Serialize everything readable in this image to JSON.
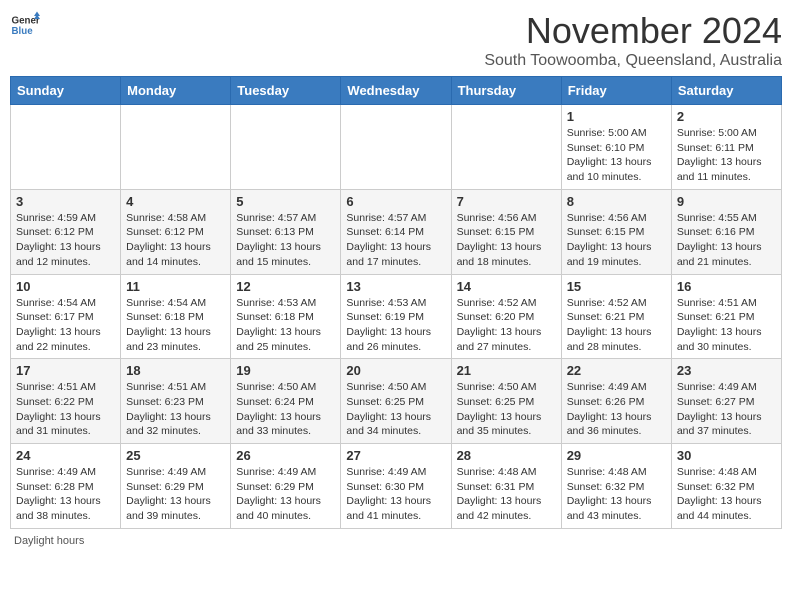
{
  "header": {
    "logo_line1": "General",
    "logo_line2": "Blue",
    "title": "November 2024",
    "subtitle": "South Toowoomba, Queensland, Australia"
  },
  "columns": [
    "Sunday",
    "Monday",
    "Tuesday",
    "Wednesday",
    "Thursday",
    "Friday",
    "Saturday"
  ],
  "weeks": [
    [
      {
        "day": "",
        "detail": ""
      },
      {
        "day": "",
        "detail": ""
      },
      {
        "day": "",
        "detail": ""
      },
      {
        "day": "",
        "detail": ""
      },
      {
        "day": "",
        "detail": ""
      },
      {
        "day": "1",
        "detail": "Sunrise: 5:00 AM\nSunset: 6:10 PM\nDaylight: 13 hours\nand 10 minutes."
      },
      {
        "day": "2",
        "detail": "Sunrise: 5:00 AM\nSunset: 6:11 PM\nDaylight: 13 hours\nand 11 minutes."
      }
    ],
    [
      {
        "day": "3",
        "detail": "Sunrise: 4:59 AM\nSunset: 6:12 PM\nDaylight: 13 hours\nand 12 minutes."
      },
      {
        "day": "4",
        "detail": "Sunrise: 4:58 AM\nSunset: 6:12 PM\nDaylight: 13 hours\nand 14 minutes."
      },
      {
        "day": "5",
        "detail": "Sunrise: 4:57 AM\nSunset: 6:13 PM\nDaylight: 13 hours\nand 15 minutes."
      },
      {
        "day": "6",
        "detail": "Sunrise: 4:57 AM\nSunset: 6:14 PM\nDaylight: 13 hours\nand 17 minutes."
      },
      {
        "day": "7",
        "detail": "Sunrise: 4:56 AM\nSunset: 6:15 PM\nDaylight: 13 hours\nand 18 minutes."
      },
      {
        "day": "8",
        "detail": "Sunrise: 4:56 AM\nSunset: 6:15 PM\nDaylight: 13 hours\nand 19 minutes."
      },
      {
        "day": "9",
        "detail": "Sunrise: 4:55 AM\nSunset: 6:16 PM\nDaylight: 13 hours\nand 21 minutes."
      }
    ],
    [
      {
        "day": "10",
        "detail": "Sunrise: 4:54 AM\nSunset: 6:17 PM\nDaylight: 13 hours\nand 22 minutes."
      },
      {
        "day": "11",
        "detail": "Sunrise: 4:54 AM\nSunset: 6:18 PM\nDaylight: 13 hours\nand 23 minutes."
      },
      {
        "day": "12",
        "detail": "Sunrise: 4:53 AM\nSunset: 6:18 PM\nDaylight: 13 hours\nand 25 minutes."
      },
      {
        "day": "13",
        "detail": "Sunrise: 4:53 AM\nSunset: 6:19 PM\nDaylight: 13 hours\nand 26 minutes."
      },
      {
        "day": "14",
        "detail": "Sunrise: 4:52 AM\nSunset: 6:20 PM\nDaylight: 13 hours\nand 27 minutes."
      },
      {
        "day": "15",
        "detail": "Sunrise: 4:52 AM\nSunset: 6:21 PM\nDaylight: 13 hours\nand 28 minutes."
      },
      {
        "day": "16",
        "detail": "Sunrise: 4:51 AM\nSunset: 6:21 PM\nDaylight: 13 hours\nand 30 minutes."
      }
    ],
    [
      {
        "day": "17",
        "detail": "Sunrise: 4:51 AM\nSunset: 6:22 PM\nDaylight: 13 hours\nand 31 minutes."
      },
      {
        "day": "18",
        "detail": "Sunrise: 4:51 AM\nSunset: 6:23 PM\nDaylight: 13 hours\nand 32 minutes."
      },
      {
        "day": "19",
        "detail": "Sunrise: 4:50 AM\nSunset: 6:24 PM\nDaylight: 13 hours\nand 33 minutes."
      },
      {
        "day": "20",
        "detail": "Sunrise: 4:50 AM\nSunset: 6:25 PM\nDaylight: 13 hours\nand 34 minutes."
      },
      {
        "day": "21",
        "detail": "Sunrise: 4:50 AM\nSunset: 6:25 PM\nDaylight: 13 hours\nand 35 minutes."
      },
      {
        "day": "22",
        "detail": "Sunrise: 4:49 AM\nSunset: 6:26 PM\nDaylight: 13 hours\nand 36 minutes."
      },
      {
        "day": "23",
        "detail": "Sunrise: 4:49 AM\nSunset: 6:27 PM\nDaylight: 13 hours\nand 37 minutes."
      }
    ],
    [
      {
        "day": "24",
        "detail": "Sunrise: 4:49 AM\nSunset: 6:28 PM\nDaylight: 13 hours\nand 38 minutes."
      },
      {
        "day": "25",
        "detail": "Sunrise: 4:49 AM\nSunset: 6:29 PM\nDaylight: 13 hours\nand 39 minutes."
      },
      {
        "day": "26",
        "detail": "Sunrise: 4:49 AM\nSunset: 6:29 PM\nDaylight: 13 hours\nand 40 minutes."
      },
      {
        "day": "27",
        "detail": "Sunrise: 4:49 AM\nSunset: 6:30 PM\nDaylight: 13 hours\nand 41 minutes."
      },
      {
        "day": "28",
        "detail": "Sunrise: 4:48 AM\nSunset: 6:31 PM\nDaylight: 13 hours\nand 42 minutes."
      },
      {
        "day": "29",
        "detail": "Sunrise: 4:48 AM\nSunset: 6:32 PM\nDaylight: 13 hours\nand 43 minutes."
      },
      {
        "day": "30",
        "detail": "Sunrise: 4:48 AM\nSunset: 6:32 PM\nDaylight: 13 hours\nand 44 minutes."
      }
    ]
  ],
  "footer": {
    "note": "Daylight hours"
  }
}
